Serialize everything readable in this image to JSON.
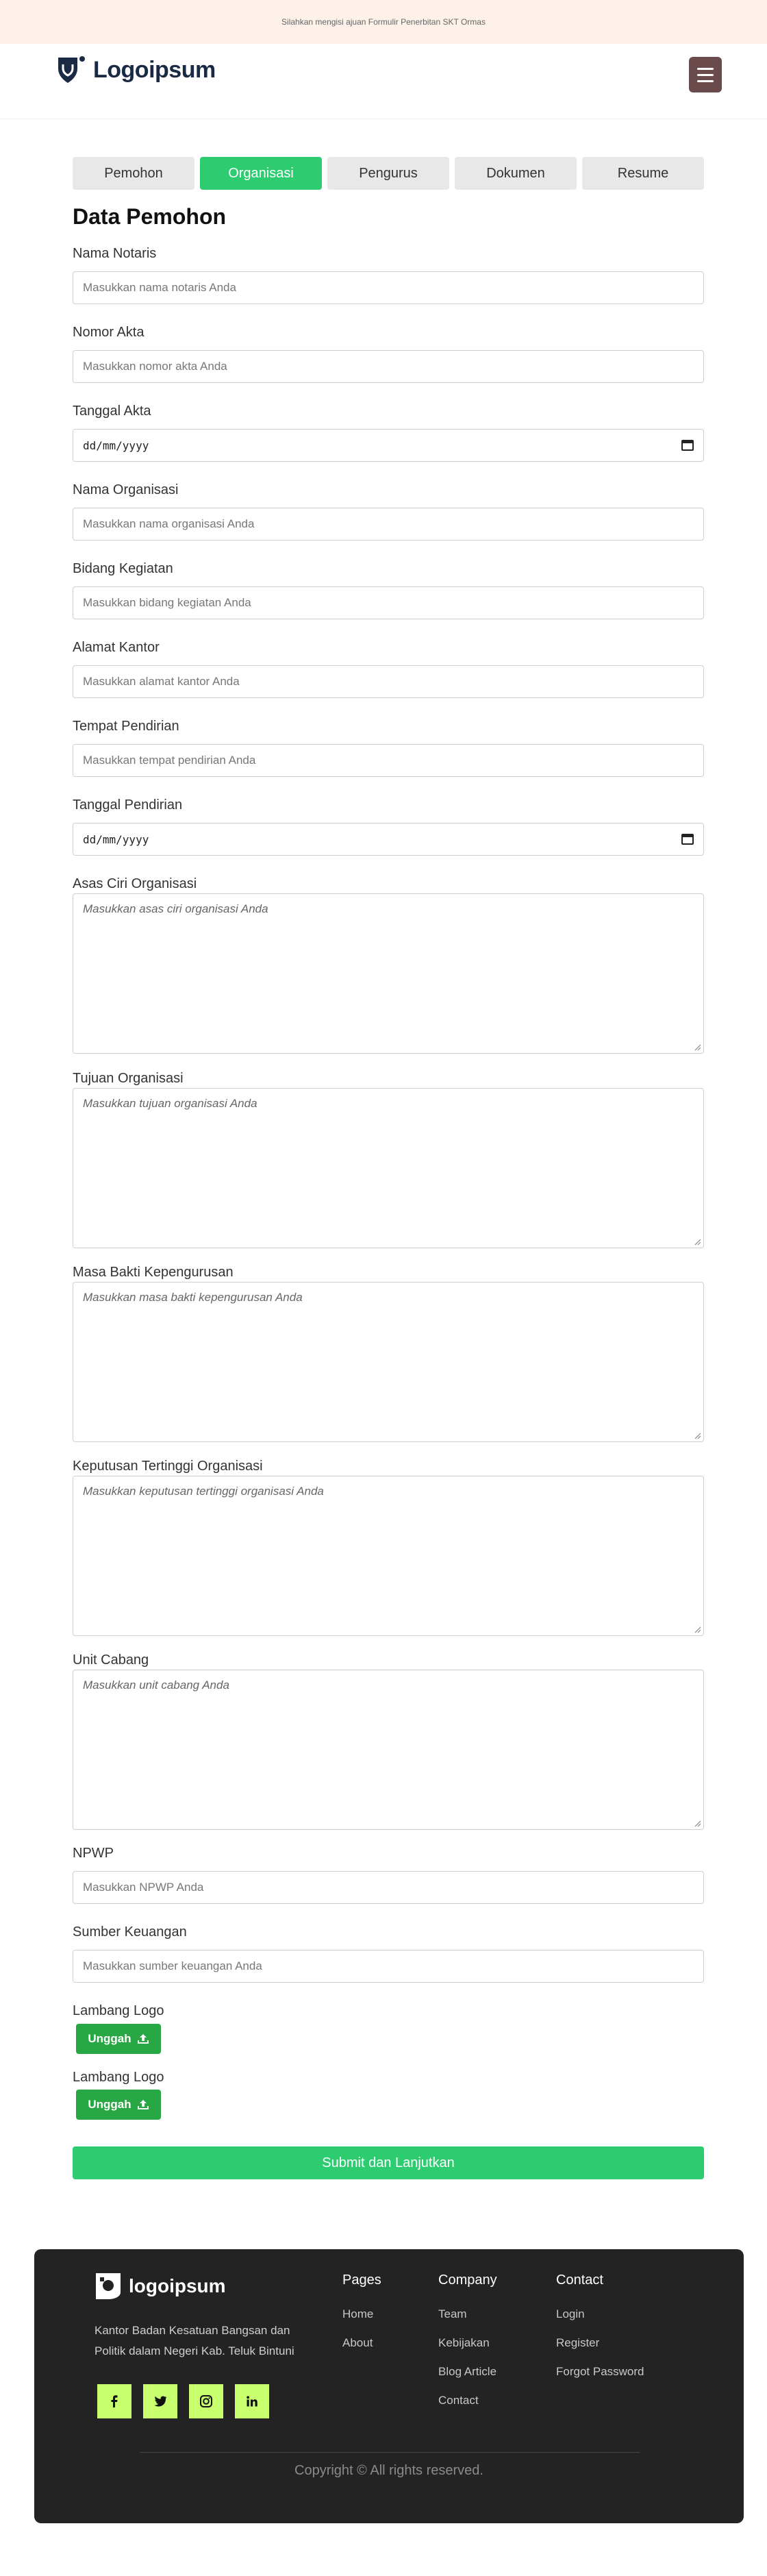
{
  "announcement": "Silahkan mengisi ajuan Formulir Penerbitan SKT Ormas",
  "header": {
    "logo_text": "Logoipsum"
  },
  "tabs": [
    {
      "label": "Pemohon",
      "active": false
    },
    {
      "label": "Organisasi",
      "active": true
    },
    {
      "label": "Pengurus",
      "active": false
    },
    {
      "label": "Dokumen",
      "active": false
    },
    {
      "label": "Resume",
      "active": false
    }
  ],
  "form": {
    "title": "Data Pemohon",
    "fields": {
      "nama_notaris": {
        "label": "Nama Notaris",
        "placeholder": "Masukkan nama notaris Anda"
      },
      "nomor_akta": {
        "label": "Nomor Akta",
        "placeholder": "Masukkan nomor akta Anda"
      },
      "tanggal_akta": {
        "label": "Tanggal Akta",
        "value": "dd/mm/yyyy"
      },
      "nama_organisasi": {
        "label": "Nama Organisasi",
        "placeholder": "Masukkan nama organisasi Anda"
      },
      "bidang_kegiatan": {
        "label": "Bidang Kegiatan",
        "placeholder": "Masukkan bidang kegiatan Anda"
      },
      "alamat_kantor": {
        "label": "Alamat Kantor",
        "placeholder": "Masukkan alamat kantor Anda"
      },
      "tempat_pendirian": {
        "label": "Tempat Pendirian",
        "placeholder": "Masukkan tempat pendirian Anda"
      },
      "tanggal_pendirian": {
        "label": "Tanggal Pendirian",
        "value": "dd/mm/yyyy"
      },
      "asas_ciri": {
        "label": "Asas Ciri Organisasi",
        "placeholder": "Masukkan asas ciri organisasi Anda"
      },
      "tujuan": {
        "label": "Tujuan Organisasi",
        "placeholder": "Masukkan tujuan organisasi Anda"
      },
      "masa_bakti": {
        "label": "Masa Bakti Kepengurusan",
        "placeholder": "Masukkan masa bakti kepengurusan Anda"
      },
      "keputusan": {
        "label": "Keputusan Tertinggi Organisasi",
        "placeholder": "Masukkan keputusan tertinggi organisasi Anda"
      },
      "unit_cabang": {
        "label": "Unit Cabang",
        "placeholder": "Masukkan unit cabang Anda"
      },
      "npwp": {
        "label": "NPWP",
        "placeholder": "Masukkan NPWP Anda"
      },
      "sumber_keuangan": {
        "label": "Sumber Keuangan",
        "placeholder": "Masukkan sumber keuangan Anda"
      },
      "lambang_logo_1": {
        "label": "Lambang Logo",
        "button": "Unggah"
      },
      "lambang_logo_2": {
        "label": "Lambang Logo",
        "button": "Unggah"
      }
    },
    "submit_label": "Submit dan Lanjutkan"
  },
  "footer": {
    "logo_text": "logoipsum",
    "description": "Kantor Badan Kesatuan Bangsan dan Politik dalam Negeri Kab. Teluk Bintuni",
    "socials": [
      {
        "icon": "facebook-icon",
        "glyph": "f"
      },
      {
        "icon": "twitter-icon",
        "glyph": "t"
      },
      {
        "icon": "instagram-icon",
        "glyph": "ig"
      },
      {
        "icon": "linkedin-icon",
        "glyph": "in"
      }
    ],
    "columns": [
      {
        "heading": "Pages",
        "links": [
          "Home",
          "About"
        ]
      },
      {
        "heading": "Company",
        "links": [
          "Team",
          "Kebijakan",
          "Blog Article",
          "Contact"
        ]
      },
      {
        "heading": "Contact",
        "links": [
          "Login",
          "Register",
          "Forgot Password"
        ]
      }
    ],
    "copyright": "Copyright © All rights reserved."
  },
  "colors": {
    "accent": "#2ecc71",
    "upload_button": "#28a745",
    "menu_button": "#6a4a4a",
    "announcement_bg": "#fdf1ea",
    "footer_bg": "#232323",
    "social_bg": "#c7ff6e"
  }
}
